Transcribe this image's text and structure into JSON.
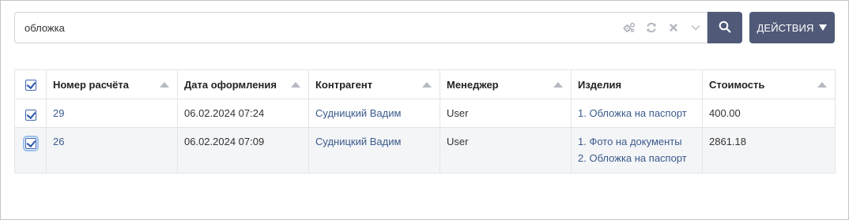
{
  "search": {
    "value": "обложка",
    "tool_icons": [
      "settings-cogs-icon",
      "refresh-icon",
      "clear-icon",
      "chevron-down-icon"
    ]
  },
  "buttons": {
    "actions_label": "ДЕЙСТВИЯ",
    "search_icon": "search-icon"
  },
  "colors": {
    "button_bg": "#505a78",
    "link": "#3a5a8c",
    "checkbox": "#2a56a8",
    "row_alt": "#f4f5f7"
  },
  "table": {
    "columns": [
      {
        "label": "Номер расчёта",
        "sortable": true
      },
      {
        "label": "Дата оформления",
        "sortable": true
      },
      {
        "label": "Контрагент",
        "sortable": true
      },
      {
        "label": "Менеджер",
        "sortable": true
      },
      {
        "label": "Изделия",
        "sortable": false
      },
      {
        "label": "Стоимость",
        "sortable": true
      }
    ],
    "rows": [
      {
        "checked": true,
        "number": "29",
        "date": "06.02.2024 07:24",
        "counterparty": "Судницкий Вадим",
        "manager": "User",
        "items": [
          "1. Обложка на паспорт"
        ],
        "cost": "400.00"
      },
      {
        "checked": true,
        "number": "26",
        "date": "06.02.2024 07:09",
        "counterparty": "Судницкий Вадим",
        "manager": "User",
        "items": [
          "1. Фото на документы",
          "2. Обложка на паспорт"
        ],
        "cost": "2861.18"
      }
    ]
  }
}
